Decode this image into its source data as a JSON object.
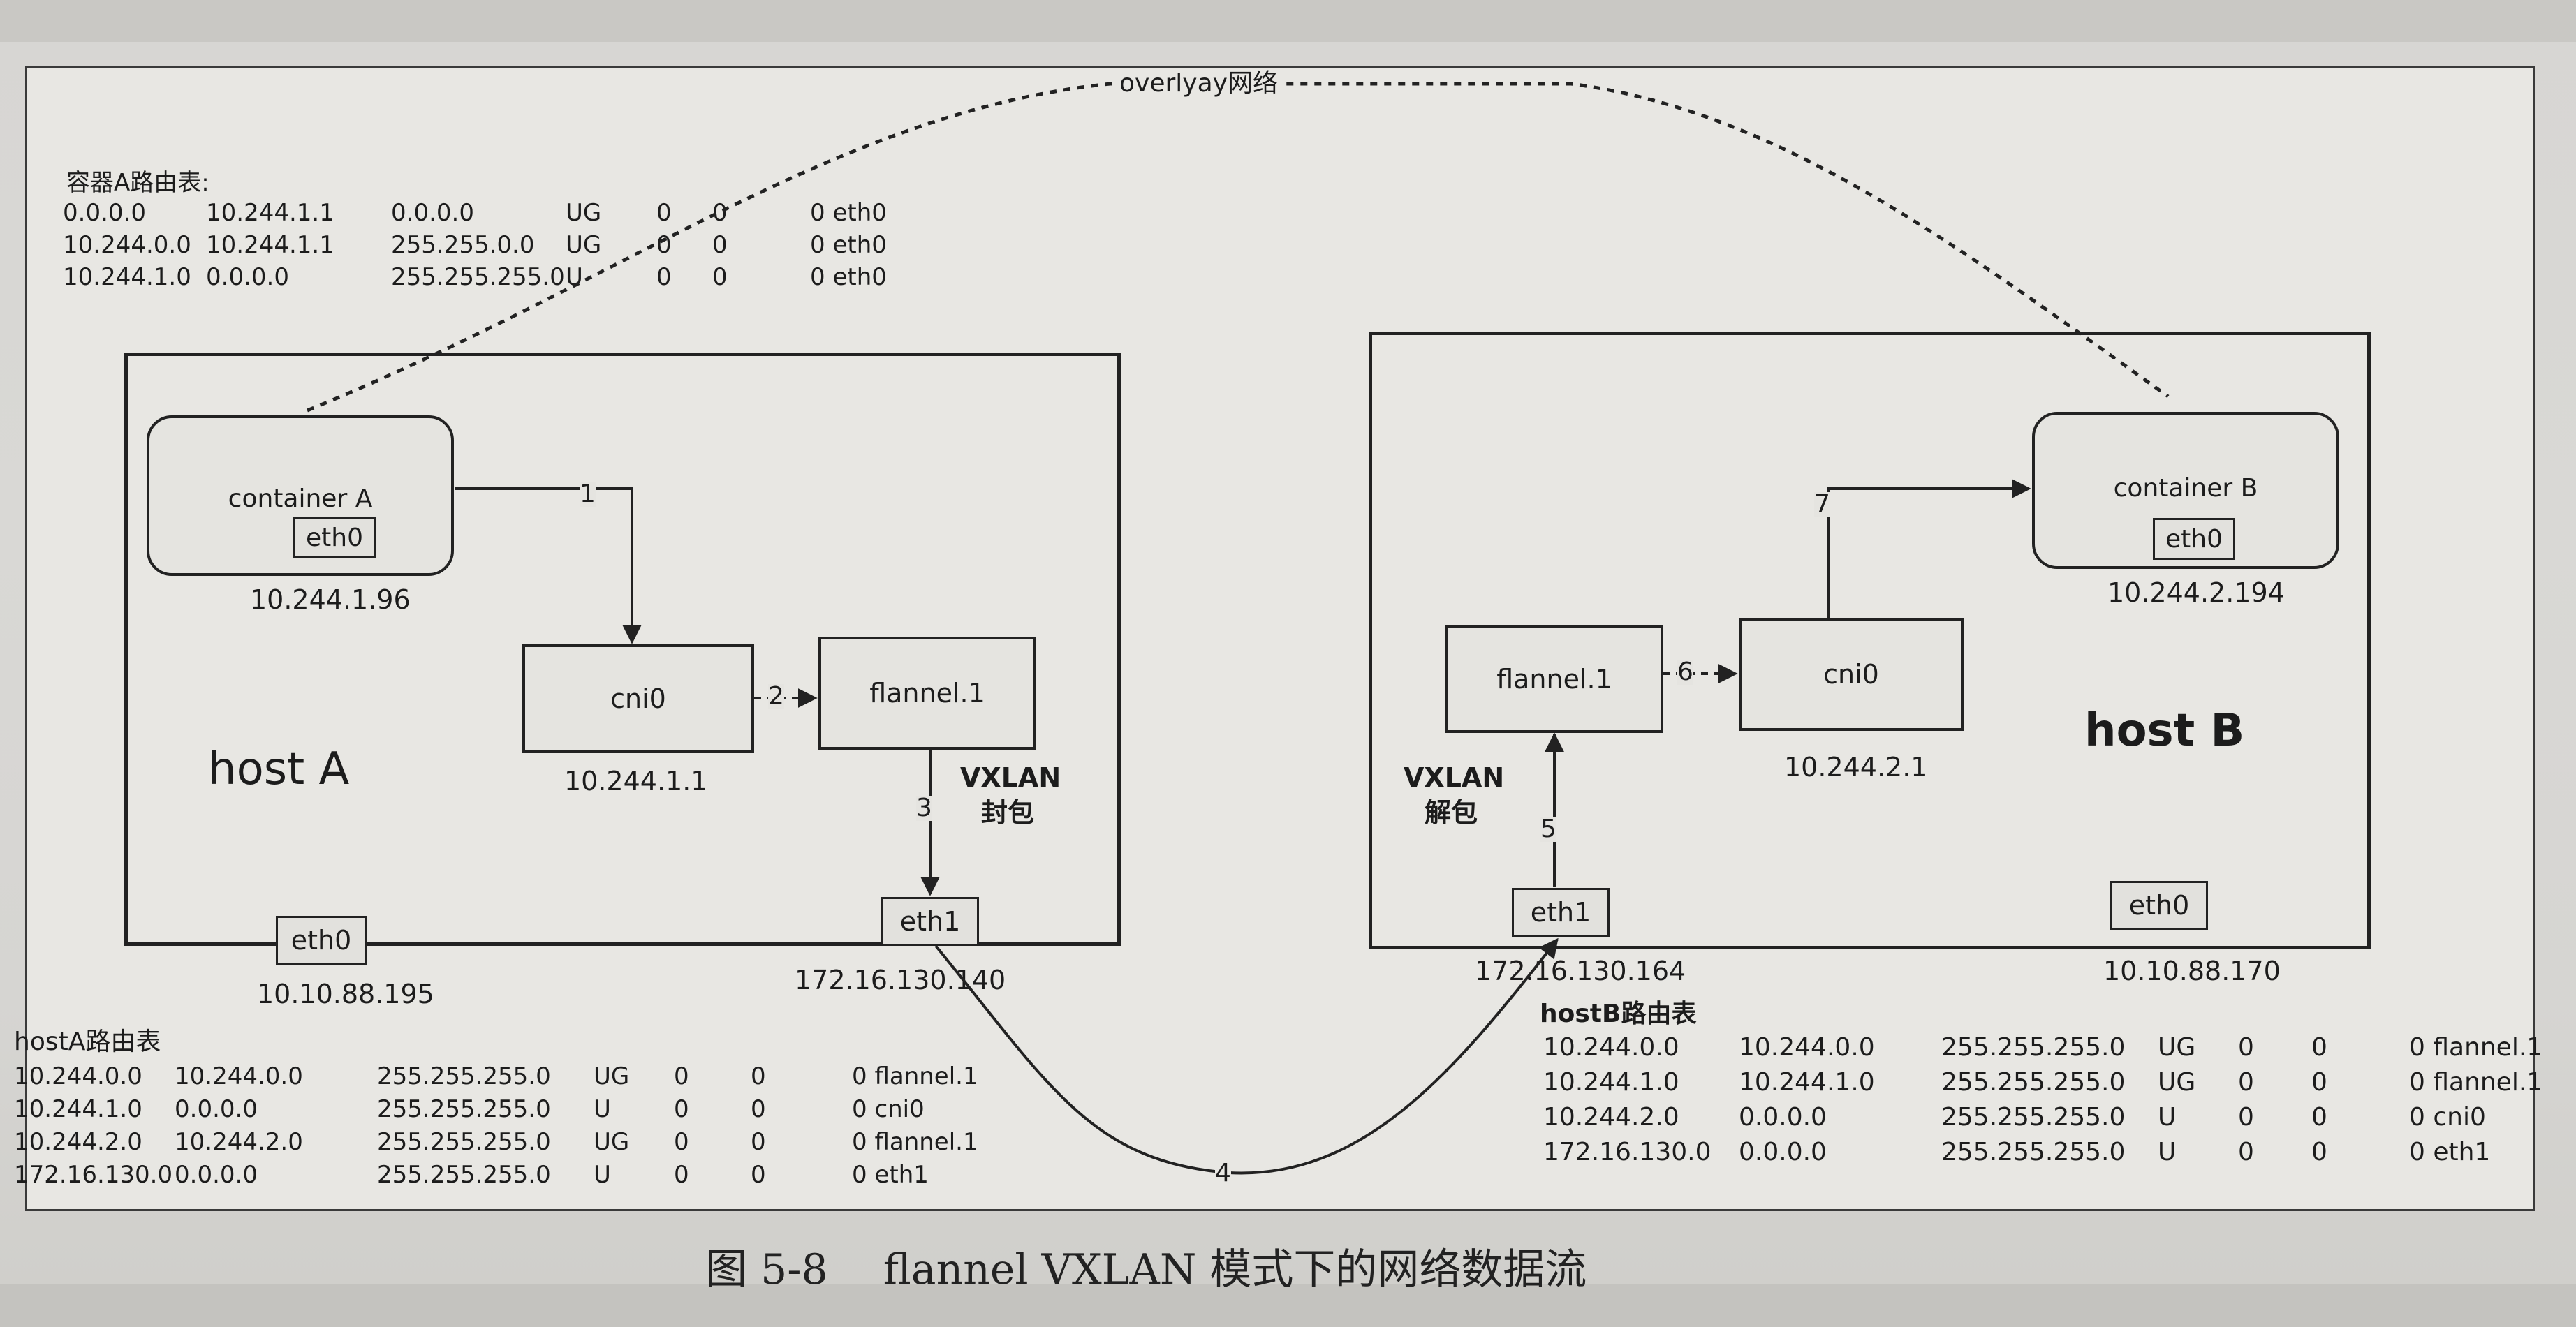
{
  "caption": {
    "number": "图 5-8",
    "text": "flannel VXLAN 模式下的网络数据流"
  },
  "overlay_label": "overlyay网络",
  "container_a_route_table": {
    "title": "容器A路由表:",
    "rows": [
      [
        "0.0.0.0",
        "10.244.1.1",
        "0.0.0.0",
        "UG",
        "0",
        "0",
        "0 eth0"
      ],
      [
        "10.244.0.0",
        "10.244.1.1",
        "255.255.0.0",
        "UG",
        "0",
        "0",
        "0 eth0"
      ],
      [
        "10.244.1.0",
        "0.0.0.0",
        "255.255.255.0",
        "U",
        "0",
        "0",
        "0 eth0"
      ]
    ]
  },
  "host_a": {
    "label": "host A",
    "container": {
      "label": "container A",
      "eth": "eth0",
      "ip": "10.244.1.96"
    },
    "cni": {
      "label": "cni0",
      "ip": "10.244.1.1"
    },
    "flannel": {
      "label": "flannel.1"
    },
    "vxlan_note": {
      "line1": "VXLAN",
      "line2": "封包"
    },
    "eth1": {
      "label": "eth1",
      "ip": "172.16.130.140"
    },
    "eth0": {
      "label": "eth0",
      "ip": "10.10.88.195"
    }
  },
  "host_b": {
    "label": "host B",
    "container": {
      "label": "container B",
      "eth": "eth0",
      "ip": "10.244.2.194"
    },
    "cni": {
      "label": "cni0",
      "ip": "10.244.2.1"
    },
    "flannel": {
      "label": "flannel.1"
    },
    "vxlan_note": {
      "line1": "VXLAN",
      "line2": "解包"
    },
    "eth1": {
      "label": "eth1",
      "ip": "172.16.130.164"
    },
    "eth0": {
      "label": "eth0",
      "ip": "10.10.88.170"
    }
  },
  "steps": [
    "1",
    "2",
    "3",
    "4",
    "5",
    "6",
    "7"
  ],
  "host_a_route_table": {
    "title": "hostA路由表",
    "rows": [
      [
        "10.244.0.0",
        "10.244.0.0",
        "255.255.255.0",
        "UG",
        "0",
        "0",
        "0 flannel.1"
      ],
      [
        "10.244.1.0",
        "0.0.0.0",
        "255.255.255.0",
        "U",
        "0",
        "0",
        "0 cni0"
      ],
      [
        "10.244.2.0",
        "10.244.2.0",
        "255.255.255.0",
        "UG",
        "0",
        "0",
        "0 flannel.1"
      ],
      [
        "172.16.130.0",
        "0.0.0.0",
        "255.255.255.0",
        "U",
        "0",
        "0",
        "0 eth1"
      ]
    ]
  },
  "host_b_route_table": {
    "title": "hostB路由表",
    "rows": [
      [
        "10.244.0.0",
        "10.244.0.0",
        "255.255.255.0",
        "UG",
        "0",
        "0",
        "0 flannel.1"
      ],
      [
        "10.244.1.0",
        "10.244.1.0",
        "255.255.255.0",
        "UG",
        "0",
        "0",
        "0 flannel.1"
      ],
      [
        "10.244.2.0",
        "0.0.0.0",
        "255.255.255.0",
        "U",
        "0",
        "0",
        "0 cni0"
      ],
      [
        "172.16.130.0",
        "0.0.0.0",
        "255.255.255.0",
        "U",
        "0",
        "0",
        "0 eth1"
      ]
    ]
  },
  "colors": {
    "paper": "#e8e7e3",
    "line": "#222222",
    "page": "#d7d6d3"
  }
}
